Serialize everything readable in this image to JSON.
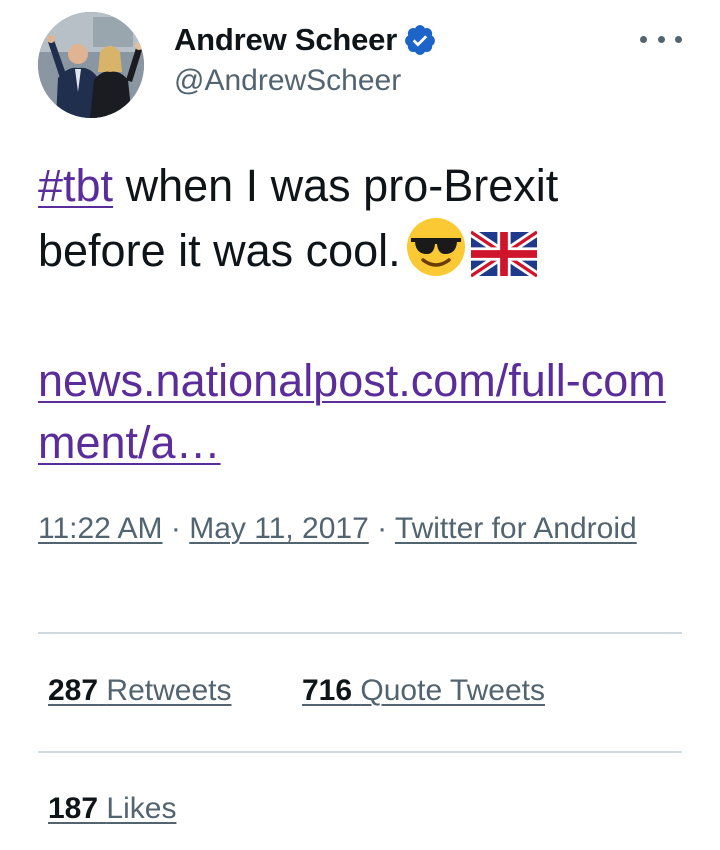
{
  "author": {
    "display_name": "Andrew Scheer",
    "handle": "@AndrewScheer",
    "verified": true,
    "verified_color": "#1d9bf0",
    "avatar_icon": "profile-photo"
  },
  "menu_icon": "more-options-icon",
  "tweet": {
    "hashtag": "#tbt",
    "text": " when I was pro-Brexit before it was cool.",
    "emojis": [
      "smiling-face-with-sunglasses",
      "flag-united-kingdom"
    ],
    "link": "news.nationalpost.com/full-comment/a…"
  },
  "meta": {
    "time": "11:22 AM",
    "date": "May 11, 2017",
    "separator": "·",
    "source": "Twitter for Android"
  },
  "stats": {
    "retweets_count": "287",
    "retweets_label": "Retweets",
    "quote_count": "716",
    "quote_label": "Quote Tweets",
    "likes_count": "187",
    "likes_label": "Likes"
  },
  "colors": {
    "link": "#5b2d9b",
    "secondary_text": "#536471",
    "divider": "#cfd9de"
  }
}
